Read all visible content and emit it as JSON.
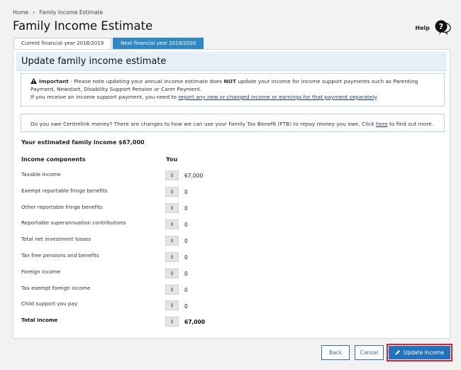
{
  "breadcrumb": {
    "home": "Home",
    "separator": "›",
    "current": "Family Income Estimate"
  },
  "page": {
    "title": "Family Income Estimate",
    "help_label": "Help"
  },
  "tabs": [
    {
      "label": "Current financial year 2018/2019",
      "selected": true
    },
    {
      "label": "Next financial year 2019/2020",
      "selected": false
    }
  ],
  "panel": {
    "title": "Update family income estimate"
  },
  "notice": {
    "important_label": "Important",
    "text1": " - Please note updating your annual income estimate does ",
    "not_word": "NOT",
    "text2": " update your income for income support payments such as Parenting Payment, Newstart, Disability Support Pension or Carer Payment.",
    "text3": "If you receive an income support payment, you need to ",
    "link": "report any new or changed income or earnings for that payment separately",
    "text4": "."
  },
  "ftb_notice": {
    "text1": "Do you owe Centrelink money? There are changes to how we can use your Family Tax Benefit (FTB) to repay money you owe. Click ",
    "link": "here",
    "text2": " to find out more."
  },
  "estimate_heading": "Your estimated family income $67,000",
  "table": {
    "col_components": "Income components",
    "col_you": "You",
    "currency": "$",
    "rows": [
      {
        "label": "Taxable income",
        "value": "67,000"
      },
      {
        "label": "Exempt reportable fringe benefits",
        "value": "0"
      },
      {
        "label": "Other reportable fringe benefits",
        "value": "0"
      },
      {
        "label": "Reportable superannuation contributions",
        "value": "0"
      },
      {
        "label": "Total net investment losses",
        "value": "0"
      },
      {
        "label": "Tax free pensions and benefits",
        "value": "0"
      },
      {
        "label": "Foreign income",
        "value": "0"
      },
      {
        "label": "Tax exempt foreign income",
        "value": "0"
      },
      {
        "label": "Child support you pay",
        "value": "0"
      }
    ],
    "total": {
      "label": "Total income",
      "value": "67,000"
    }
  },
  "buttons": {
    "back": "Back",
    "cancel": "Cancel",
    "update": "Update Income"
  },
  "colors": {
    "accent": "#2173c0",
    "highlight": "#e0202c"
  },
  "icons": {
    "help": "help-question-icon",
    "warning": "warning-icon",
    "update": "pencil-icon"
  }
}
